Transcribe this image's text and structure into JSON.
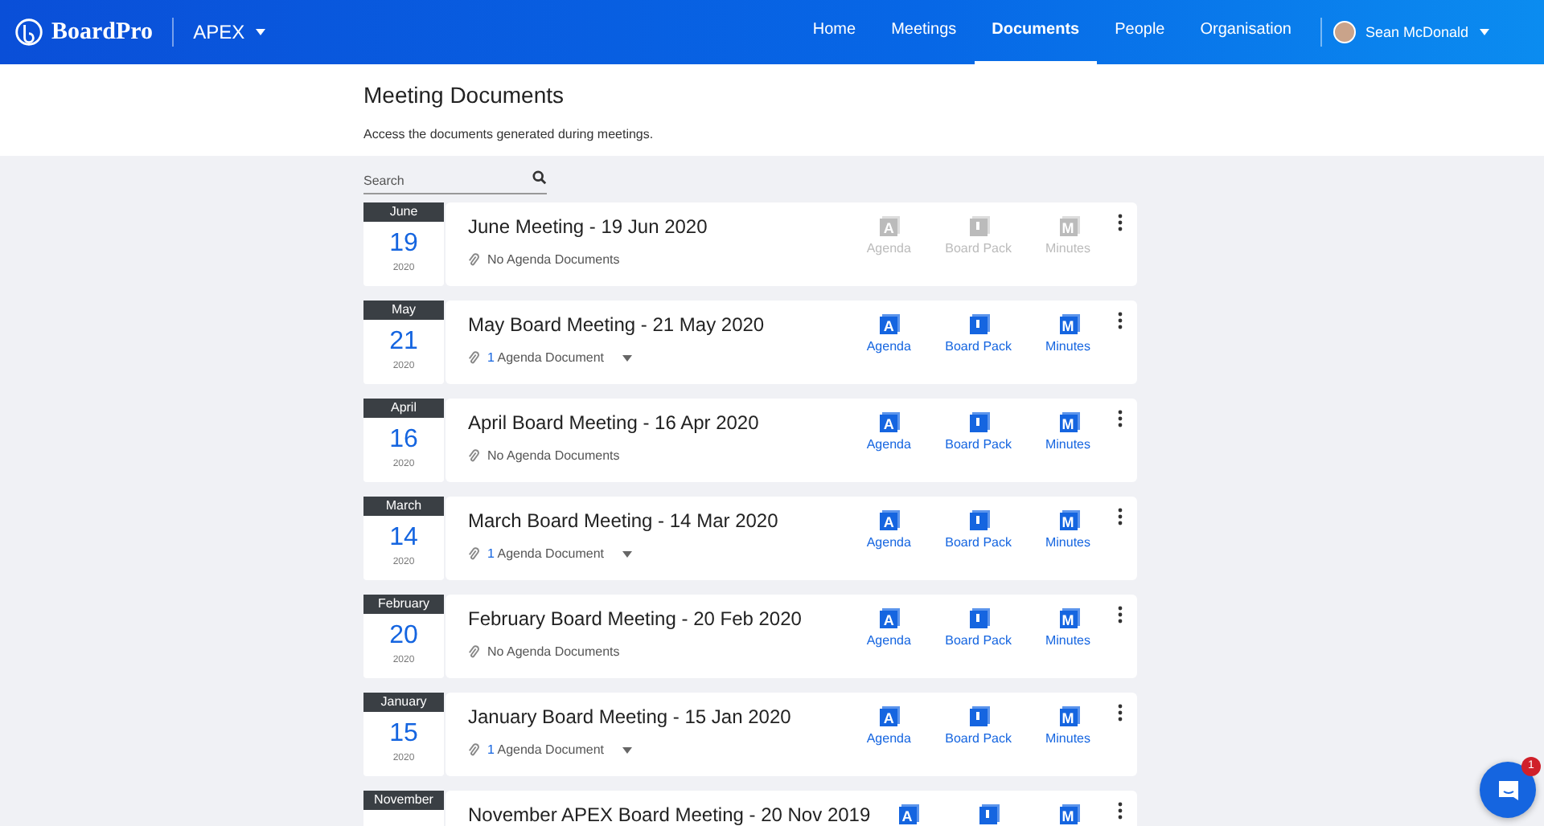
{
  "header": {
    "brand": "BoardPro",
    "org": "APEX",
    "nav": [
      {
        "label": "Home",
        "selected": false
      },
      {
        "label": "Meetings",
        "selected": false
      },
      {
        "label": "Documents",
        "selected": true
      },
      {
        "label": "People",
        "selected": false
      },
      {
        "label": "Organisation",
        "selected": false
      }
    ],
    "user": "Sean McDonald"
  },
  "page": {
    "title": "Meeting Documents",
    "subtitle": "Access the documents generated during meetings."
  },
  "search": {
    "placeholder": "Search"
  },
  "meetings": [
    {
      "month": "June",
      "day": "19",
      "year": "2020",
      "title": "June Meeting - 19 Jun 2020",
      "attachments": {
        "label": "No Agenda Documents",
        "expandable": false
      },
      "docs": [
        {
          "letter": "A",
          "kind": "letter",
          "label": "Agenda",
          "available": false
        },
        {
          "kind": "pack",
          "label": "Board Pack",
          "available": false
        },
        {
          "letter": "M",
          "kind": "letter",
          "label": "Minutes",
          "available": false
        }
      ]
    },
    {
      "month": "May",
      "day": "21",
      "year": "2020",
      "title": "May Board Meeting - 21 May 2020",
      "attachments": {
        "count": "1",
        "label": "Agenda Document",
        "expandable": true
      },
      "docs": [
        {
          "letter": "A",
          "kind": "letter",
          "label": "Agenda",
          "available": true
        },
        {
          "kind": "pack",
          "label": "Board Pack",
          "available": true
        },
        {
          "letter": "M",
          "kind": "letter",
          "label": "Minutes",
          "available": true
        }
      ]
    },
    {
      "month": "April",
      "day": "16",
      "year": "2020",
      "title": "April Board Meeting - 16 Apr 2020",
      "attachments": {
        "label": "No Agenda Documents",
        "expandable": false
      },
      "docs": [
        {
          "letter": "A",
          "kind": "letter",
          "label": "Agenda",
          "available": true
        },
        {
          "kind": "pack",
          "label": "Board Pack",
          "available": true
        },
        {
          "letter": "M",
          "kind": "letter",
          "label": "Minutes",
          "available": true
        }
      ]
    },
    {
      "month": "March",
      "day": "14",
      "year": "2020",
      "title": "March Board Meeting - 14 Mar 2020",
      "attachments": {
        "count": "1",
        "label": "Agenda Document",
        "expandable": true
      },
      "docs": [
        {
          "letter": "A",
          "kind": "letter",
          "label": "Agenda",
          "available": true
        },
        {
          "kind": "pack",
          "label": "Board Pack",
          "available": true
        },
        {
          "letter": "M",
          "kind": "letter",
          "label": "Minutes",
          "available": true
        }
      ]
    },
    {
      "month": "February",
      "day": "20",
      "year": "2020",
      "title": "February Board Meeting - 20 Feb 2020",
      "attachments": {
        "label": "No Agenda Documents",
        "expandable": false
      },
      "docs": [
        {
          "letter": "A",
          "kind": "letter",
          "label": "Agenda",
          "available": true
        },
        {
          "kind": "pack",
          "label": "Board Pack",
          "available": true
        },
        {
          "letter": "M",
          "kind": "letter",
          "label": "Minutes",
          "available": true
        }
      ]
    },
    {
      "month": "January",
      "day": "15",
      "year": "2020",
      "title": "January Board Meeting - 15 Jan 2020",
      "attachments": {
        "count": "1",
        "label": "Agenda Document",
        "expandable": true
      },
      "docs": [
        {
          "letter": "A",
          "kind": "letter",
          "label": "Agenda",
          "available": true
        },
        {
          "kind": "pack",
          "label": "Board Pack",
          "available": true
        },
        {
          "letter": "M",
          "kind": "letter",
          "label": "Minutes",
          "available": true
        }
      ]
    },
    {
      "month": "November",
      "title": "November APEX Board Meeting - 20 Nov 2019",
      "docs": [
        {
          "letter": "A",
          "kind": "letter",
          "available": true
        },
        {
          "kind": "pack",
          "available": true
        },
        {
          "letter": "M",
          "kind": "letter",
          "available": true
        }
      ]
    }
  ],
  "chat": {
    "badge": "1"
  }
}
